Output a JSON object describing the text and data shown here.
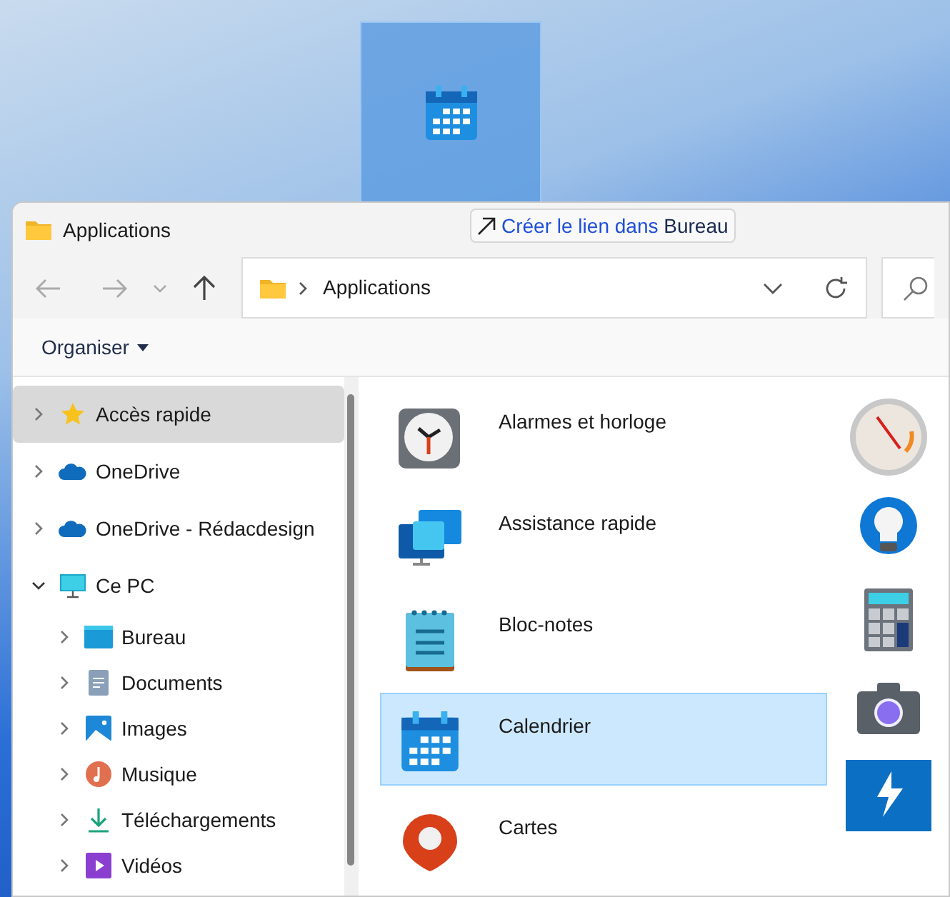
{
  "drag_tooltip": {
    "action": "Créer le lien dans",
    "target": "Bureau"
  },
  "window": {
    "title": "Applications"
  },
  "address_bar": {
    "path": "Applications"
  },
  "command_bar": {
    "organise": "Organiser"
  },
  "sidebar": {
    "items": [
      {
        "label": "Accès rapide",
        "kind": "star",
        "selected": true,
        "expanded": false
      },
      {
        "label": "OneDrive",
        "kind": "cloud",
        "selected": false,
        "expanded": false
      },
      {
        "label": "OneDrive - Rédacdesign",
        "kind": "cloud",
        "selected": false,
        "expanded": false
      },
      {
        "label": "Ce PC",
        "kind": "pc",
        "selected": false,
        "expanded": true,
        "children": [
          {
            "label": "Bureau",
            "kind": "desktop",
            "selected": false,
            "expanded": false
          },
          {
            "label": "Documents",
            "kind": "documents",
            "selected": false,
            "expanded": false
          },
          {
            "label": "Images",
            "kind": "images",
            "selected": false,
            "expanded": false
          },
          {
            "label": "Musique",
            "kind": "music",
            "selected": false,
            "expanded": false
          },
          {
            "label": "Téléchargements",
            "kind": "downloads",
            "selected": false,
            "expanded": false
          },
          {
            "label": "Vidéos",
            "kind": "videos",
            "selected": false,
            "expanded": false
          }
        ]
      }
    ]
  },
  "apps": [
    {
      "label": "Alarmes et horloge",
      "selected": false
    },
    {
      "label": "Assistance rapide",
      "selected": false
    },
    {
      "label": "Bloc-notes",
      "selected": false
    },
    {
      "label": "Calendrier",
      "selected": true
    },
    {
      "label": "Cartes",
      "selected": false
    }
  ]
}
